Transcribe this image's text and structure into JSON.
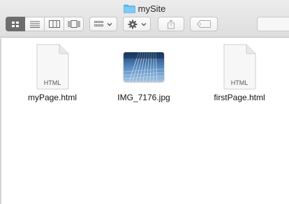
{
  "window": {
    "title": "mySite",
    "folder_icon": "folder-icon",
    "accent": "#5eb8f0"
  },
  "toolbar": {
    "view_modes": [
      {
        "icon": "icon-view-icon",
        "active": true
      },
      {
        "icon": "list-view-icon",
        "active": false
      },
      {
        "icon": "column-view-icon",
        "active": false
      },
      {
        "icon": "cover-flow-view-icon",
        "active": false
      }
    ],
    "arrange_icon": "arrange-grid-icon",
    "action_icon": "gear-icon",
    "share_icon": "share-icon",
    "tag_icon": "tag-icon"
  },
  "files": [
    {
      "name": "myPage.html",
      "type_label": "HTML",
      "kind": "document"
    },
    {
      "name": "IMG_7176.jpg",
      "type_label": "",
      "kind": "image"
    },
    {
      "name": "firstPage.html",
      "type_label": "HTML",
      "kind": "document"
    }
  ]
}
